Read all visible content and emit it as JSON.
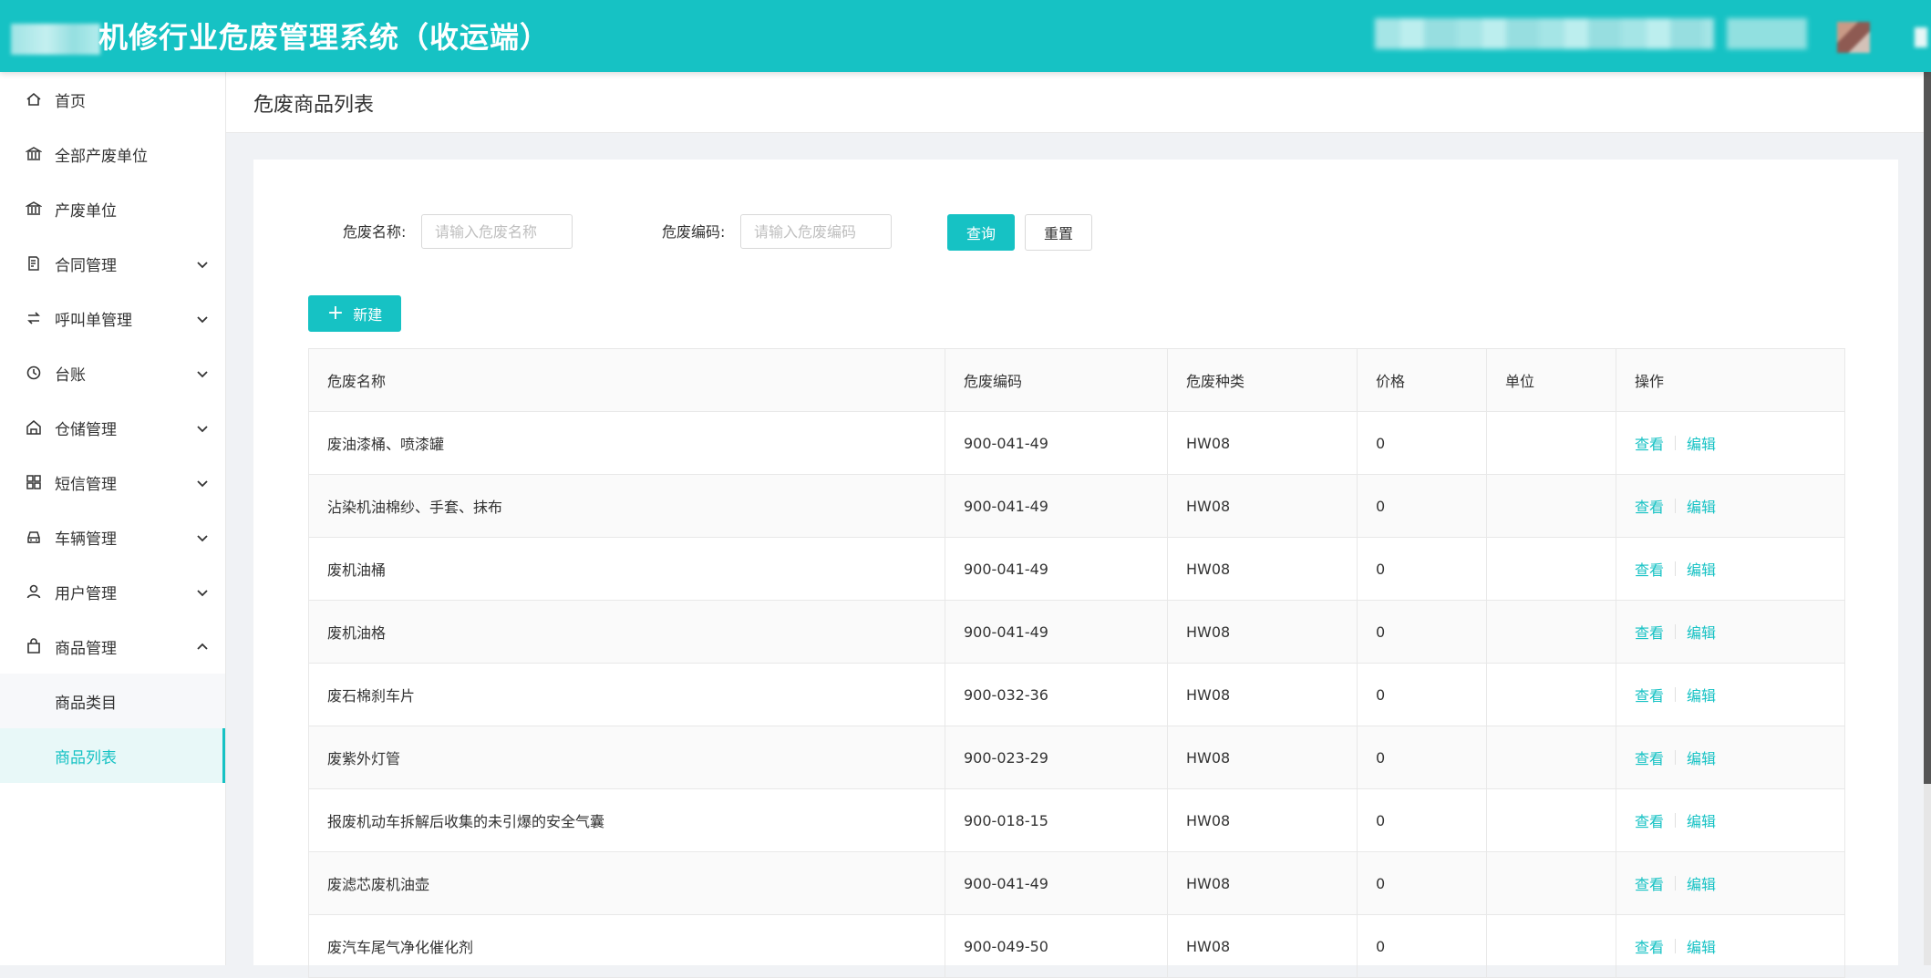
{
  "header": {
    "title": "机修行业危废管理系统（收运端）"
  },
  "sidebar": {
    "items": [
      {
        "label": "首页",
        "icon": "home-icon",
        "expandable": false
      },
      {
        "label": "全部产废单位",
        "icon": "bank-icon",
        "expandable": false
      },
      {
        "label": "产废单位",
        "icon": "bank-icon",
        "expandable": false
      },
      {
        "label": "合同管理",
        "icon": "contract-icon",
        "expandable": true
      },
      {
        "label": "呼叫单管理",
        "icon": "swap-icon",
        "expandable": true
      },
      {
        "label": "台账",
        "icon": "clock-icon",
        "expandable": true
      },
      {
        "label": "仓储管理",
        "icon": "warehouse-icon",
        "expandable": true
      },
      {
        "label": "短信管理",
        "icon": "grid-icon",
        "expandable": true
      },
      {
        "label": "车辆管理",
        "icon": "car-icon",
        "expandable": true
      },
      {
        "label": "用户管理",
        "icon": "user-icon",
        "expandable": true
      },
      {
        "label": "商品管理",
        "icon": "shopping-bag-icon",
        "expandable": true,
        "expanded": true
      }
    ],
    "submenu": [
      {
        "label": "商品类目",
        "active": false
      },
      {
        "label": "商品列表",
        "active": true
      }
    ]
  },
  "page": {
    "title": "危废商品列表"
  },
  "filters": {
    "name_label": "危废名称:",
    "name_placeholder": "请输入危废名称",
    "code_label": "危废编码:",
    "code_placeholder": "请输入危废编码",
    "query_label": "查询",
    "reset_label": "重置",
    "new_label": "新建"
  },
  "table": {
    "columns": [
      "危废名称",
      "危废编码",
      "危废种类",
      "价格",
      "单位",
      "操作"
    ],
    "action_view": "查看",
    "action_edit": "编辑",
    "rows": [
      {
        "name": "废油漆桶、喷漆罐",
        "code": "900-041-49",
        "category": "HW08",
        "price": "0",
        "unit": ""
      },
      {
        "name": "沾染机油棉纱、手套、抹布",
        "code": "900-041-49",
        "category": "HW08",
        "price": "0",
        "unit": ""
      },
      {
        "name": "废机油桶",
        "code": "900-041-49",
        "category": "HW08",
        "price": "0",
        "unit": ""
      },
      {
        "name": "废机油格",
        "code": "900-041-49",
        "category": "HW08",
        "price": "0",
        "unit": ""
      },
      {
        "name": "废石棉刹车片",
        "code": "900-032-36",
        "category": "HW08",
        "price": "0",
        "unit": ""
      },
      {
        "name": "废紫外灯管",
        "code": "900-023-29",
        "category": "HW08",
        "price": "0",
        "unit": ""
      },
      {
        "name": "报废机动车拆解后收集的未引爆的安全气囊",
        "code": "900-018-15",
        "category": "HW08",
        "price": "0",
        "unit": ""
      },
      {
        "name": "废滤芯废机油壶",
        "code": "900-041-49",
        "category": "HW08",
        "price": "0",
        "unit": ""
      },
      {
        "name": "废汽车尾气净化催化剂",
        "code": "900-049-50",
        "category": "HW08",
        "price": "0",
        "unit": ""
      }
    ]
  },
  "colors": {
    "primary": "#16c2c4",
    "link": "#16c2c4"
  }
}
